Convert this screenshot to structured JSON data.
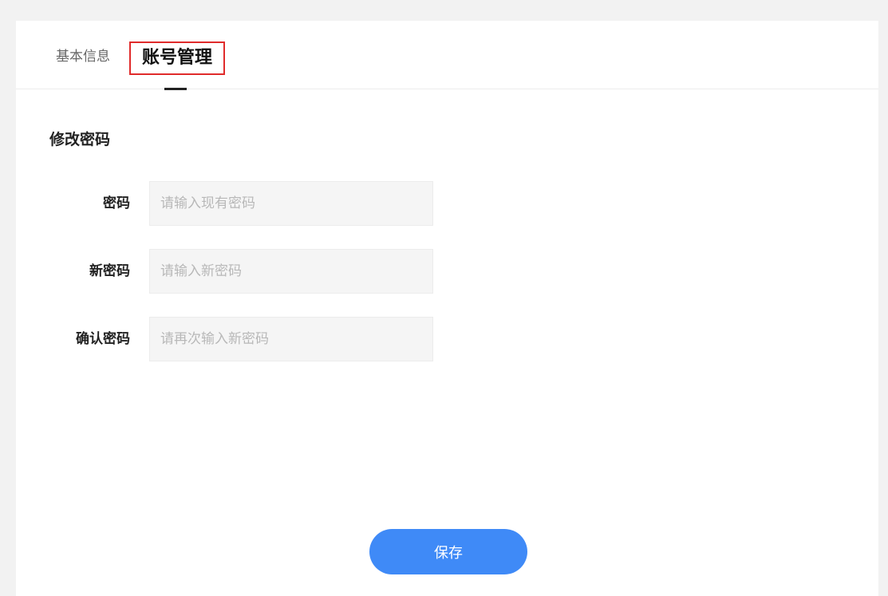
{
  "tabs": {
    "basic_info": "基本信息",
    "account_management": "账号管理"
  },
  "section": {
    "title": "修改密码"
  },
  "form": {
    "current_password": {
      "label": "密码",
      "placeholder": "请输入现有密码"
    },
    "new_password": {
      "label": "新密码",
      "placeholder": "请输入新密码"
    },
    "confirm_password": {
      "label": "确认密码",
      "placeholder": "请再次输入新密码"
    }
  },
  "actions": {
    "save_label": "保存"
  },
  "colors": {
    "accent": "#3f8af7",
    "highlight_border": "#e02b2b",
    "background": "#f2f2f2"
  }
}
